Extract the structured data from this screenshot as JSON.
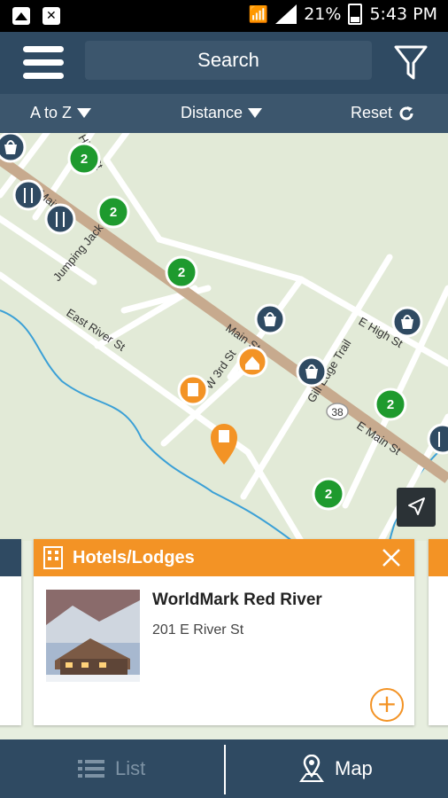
{
  "status": {
    "battery": "21%",
    "time": "5:43 PM"
  },
  "header": {
    "search_label": "Search",
    "menu_icon": "hamburger-menu-icon",
    "filter_icon": "filter-funnel-icon"
  },
  "sort": {
    "alpha_label": "A to Z",
    "distance_label": "Distance",
    "reset_label": "Reset"
  },
  "map": {
    "streets": [
      "High St",
      "W Main St",
      "Jumping Jack",
      "East River St",
      "Main St",
      "W 3rd St",
      "Gill Edge Trail",
      "E High St",
      "E Main St"
    ],
    "route_marker": "38",
    "cluster_count": "2"
  },
  "card": {
    "category": "Hotels/Lodges",
    "title": "WorldMark Red River",
    "address": "201 E River St"
  },
  "bottom": {
    "list_label": "List",
    "map_label": "Map"
  },
  "colors": {
    "header": "#2f4a62",
    "accent": "#f39325",
    "cluster": "#1e9a2e"
  }
}
